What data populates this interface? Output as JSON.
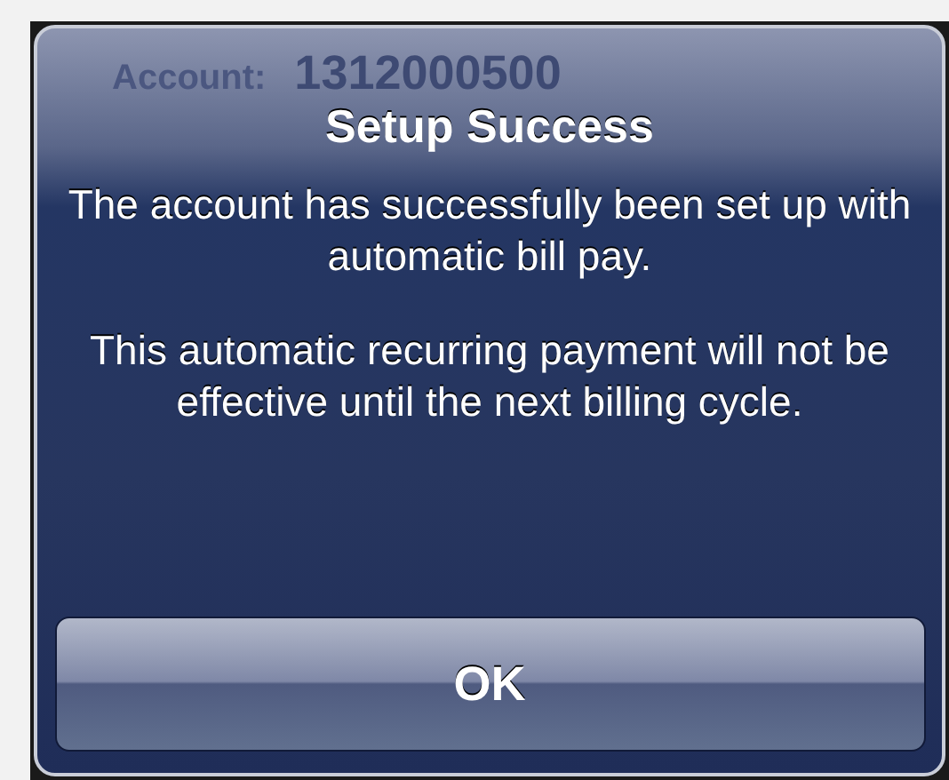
{
  "background": {
    "account_label": "Account:",
    "account_number": "1312000500"
  },
  "alert": {
    "title": "Setup Success",
    "message": [
      "The account has successfully been set up with automatic bill pay.",
      "This automatic recurring payment will not be effective until the next billing cycle."
    ],
    "buttons": [
      "OK"
    ]
  }
}
